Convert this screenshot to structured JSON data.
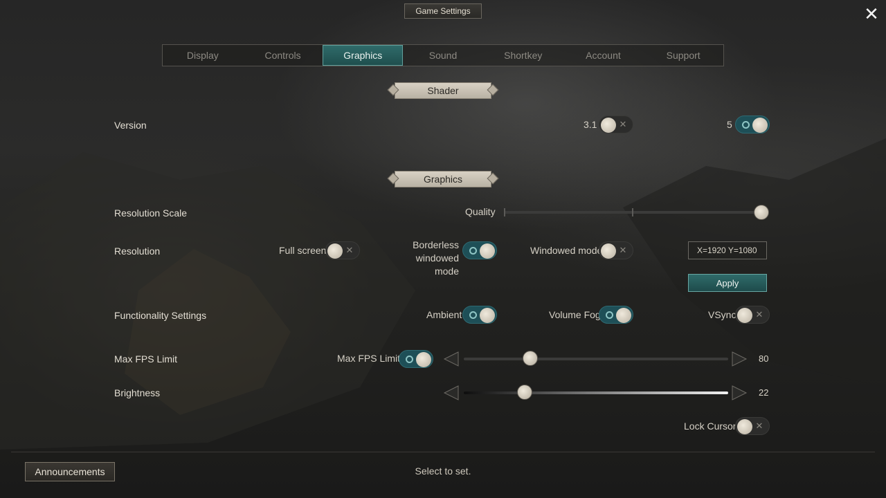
{
  "header": {
    "title": "Game Settings",
    "close_label": "✕"
  },
  "tabs": [
    {
      "label": "Display",
      "active": false
    },
    {
      "label": "Controls",
      "active": false
    },
    {
      "label": "Graphics",
      "active": true
    },
    {
      "label": "Sound",
      "active": false
    },
    {
      "label": "Shortkey",
      "active": false
    },
    {
      "label": "Account",
      "active": false
    },
    {
      "label": "Support",
      "active": false
    }
  ],
  "sections": {
    "shader": "Shader",
    "graphics": "Graphics"
  },
  "version": {
    "label": "Version",
    "option_a": {
      "label": "3.1",
      "state": "off"
    },
    "option_b": {
      "label": "5",
      "state": "on"
    }
  },
  "resolution_scale": {
    "label": "Resolution Scale",
    "mode_label": "Quality",
    "level": 1.0
  },
  "resolution": {
    "label": "Resolution",
    "full_screen": {
      "label": "Full screen",
      "state": "off"
    },
    "borderless_line1": "Borderless windowed",
    "borderless_line2": "mode",
    "borderless_state": "on",
    "windowed": {
      "label": "Windowed mode",
      "state": "off"
    },
    "value": "X=1920  Y=1080",
    "apply_label": "Apply"
  },
  "functionality": {
    "label": "Functionality Settings",
    "ambient": {
      "label": "Ambient",
      "state": "on"
    },
    "volume_fog": {
      "label": "Volume Fog",
      "state": "on"
    },
    "vsync": {
      "label": "VSync",
      "state": "off"
    }
  },
  "max_fps": {
    "label": "Max FPS Limit",
    "toggle_label": "Max FPS Limit",
    "toggle_state": "on",
    "value": "80",
    "level": 0.25
  },
  "brightness": {
    "label": "Brightness",
    "value": "22",
    "level": 0.23
  },
  "lock_cursor": {
    "label": "Lock Cursor",
    "state": "off"
  },
  "footer": {
    "announcements_label": "Announcements",
    "hint": "Select to set."
  },
  "colors": {
    "accent": "#1e4f57",
    "accent_border": "#62a09c",
    "text": "#d9d4c8"
  }
}
